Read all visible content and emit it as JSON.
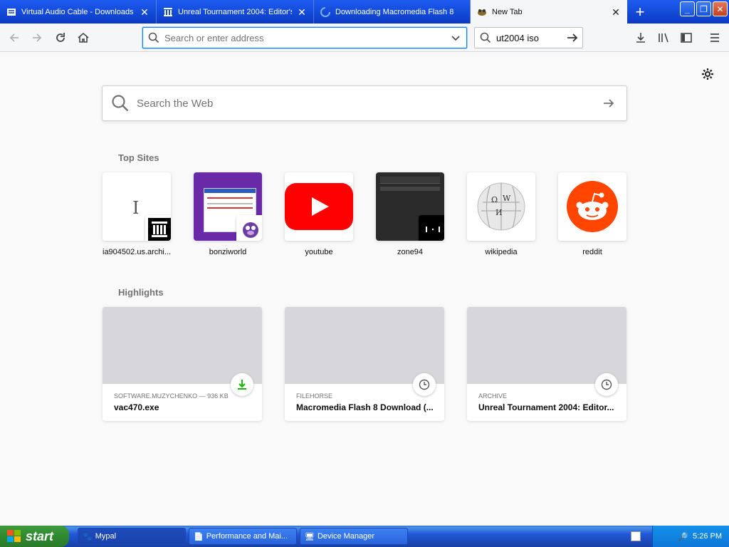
{
  "tabs": [
    {
      "title": "Virtual Audio Cable - Downloads",
      "icon": "vac-favicon-icon",
      "active": false
    },
    {
      "title": "Unreal Tournament 2004: Editor's",
      "icon": "archive-favicon-icon",
      "active": false
    },
    {
      "title": "Downloading Macromedia Flash 8",
      "icon": "loading-spinner-icon",
      "active": false
    },
    {
      "title": "New Tab",
      "icon": "newtab-favicon-icon",
      "active": true
    }
  ],
  "urlbar": {
    "placeholder": "Search or enter address"
  },
  "searchbar": {
    "query": "ut2004 iso"
  },
  "websearch": {
    "placeholder": "Search the Web"
  },
  "top_sites_title": "Top Sites",
  "top_sites": [
    {
      "label": "ia904502.us.archi..."
    },
    {
      "label": "bonziworld"
    },
    {
      "label": "youtube"
    },
    {
      "label": "zone94"
    },
    {
      "label": "wikipedia"
    },
    {
      "label": "reddit"
    }
  ],
  "highlights_title": "Highlights",
  "highlights": [
    {
      "host": "SOFTWARE.MUZYCHENKO — 936 KB",
      "title": "vac470.exe",
      "icon": "download-icon"
    },
    {
      "host": "FILEHORSE",
      "title": "Macromedia Flash 8 Download (...",
      "icon": "clock-icon"
    },
    {
      "host": "ARCHIVE",
      "title": "Unreal Tournament 2004: Editor...",
      "icon": "clock-icon"
    }
  ],
  "taskbar": {
    "start_label": "start",
    "items": [
      {
        "label": "Mypal",
        "active": true
      },
      {
        "label": "Performance and Mai...",
        "active": false
      },
      {
        "label": "Device Manager",
        "active": false
      }
    ],
    "clock": "5:26 PM"
  },
  "colors": {
    "accent": "#0a84ff",
    "titlebar": "#0b3bc4",
    "youtube": "#ff0000",
    "reddit": "#ff4500",
    "download_green": "#12bc00"
  }
}
